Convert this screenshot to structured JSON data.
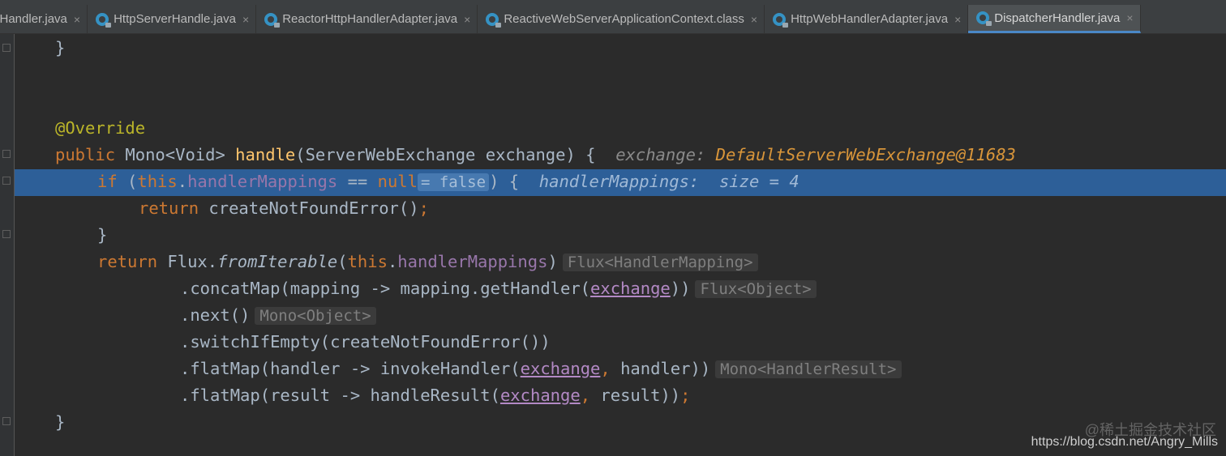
{
  "tabs": [
    {
      "label": "cHandler.java",
      "icon": "",
      "active": false
    },
    {
      "label": "HttpServerHandle.java",
      "icon": "class-icon",
      "active": false
    },
    {
      "label": "ReactorHttpHandlerAdapter.java",
      "icon": "class-icon",
      "active": false
    },
    {
      "label": "ReactiveWebServerApplicationContext.class",
      "icon": "class-icon",
      "active": false
    },
    {
      "label": "HttpWebHandlerAdapter.java",
      "icon": "class-icon",
      "active": false
    },
    {
      "label": "DispatcherHandler.java",
      "icon": "class-icon",
      "active": true
    }
  ],
  "close_glyph": "×",
  "code": {
    "l1_brace": "}",
    "annotation": "@Override",
    "sig_public": "public",
    "sig_type": " Mono<Void> ",
    "sig_name": "handle",
    "sig_params": "(ServerWebExchange exchange) {",
    "sig_dbg_label": "exchange:",
    "sig_dbg_value": "DefaultServerWebExchange@11683",
    "if_kw": "if",
    "if_open": " (",
    "if_this": "this",
    "if_dot": ".",
    "if_field": "handlerMappings",
    "if_eq": " == ",
    "if_null": "null",
    "if_hint": "= false",
    "if_close": ") {",
    "if_dbg": "handlerMappings:  size = 4",
    "ret1_kw": "return",
    "ret1_rest": " createNotFoundError()",
    "ret1_semi": ";",
    "close_brace": "}",
    "ret2_kw": "return",
    "ret2_flux": " Flux.",
    "ret2_method": "fromIterable",
    "ret2_open": "(",
    "ret2_this": "this",
    "ret2_dot": ".",
    "ret2_field": "handlerMappings",
    "ret2_close": ")",
    "ret2_hint": "Flux<HandlerMapping>",
    "c1_a": ".concatMap(mapping -> mapping.getHandler(",
    "c1_param": "exchange",
    "c1_b": "))",
    "c1_hint": "Flux<Object>",
    "c2_a": ".next()",
    "c2_hint": "Mono<Object>",
    "c3_a": ".switchIfEmpty(createNotFoundError())",
    "c4_a": ".flatMap(handler -> invokeHandler(",
    "c4_param": "exchange",
    "c4_comma": ",",
    "c4_b": " handler))",
    "c4_hint": "Mono<HandlerResult>",
    "c5_a": ".flatMap(result -> handleResult(",
    "c5_param": "exchange",
    "c5_comma": ",",
    "c5_b": " result))",
    "c5_semi": ";",
    "end_brace": "}"
  },
  "watermark": {
    "site": "@稀土掘金技术社区",
    "url": "https://blog.csdn.net/Angry_Mills"
  },
  "colors": {
    "editor_bg": "#2b2b2b",
    "highlight": "#2d5f98",
    "keyword": "#cc7832",
    "annotation": "#bbb529",
    "method": "#ffc66d",
    "field": "#9876aa"
  }
}
